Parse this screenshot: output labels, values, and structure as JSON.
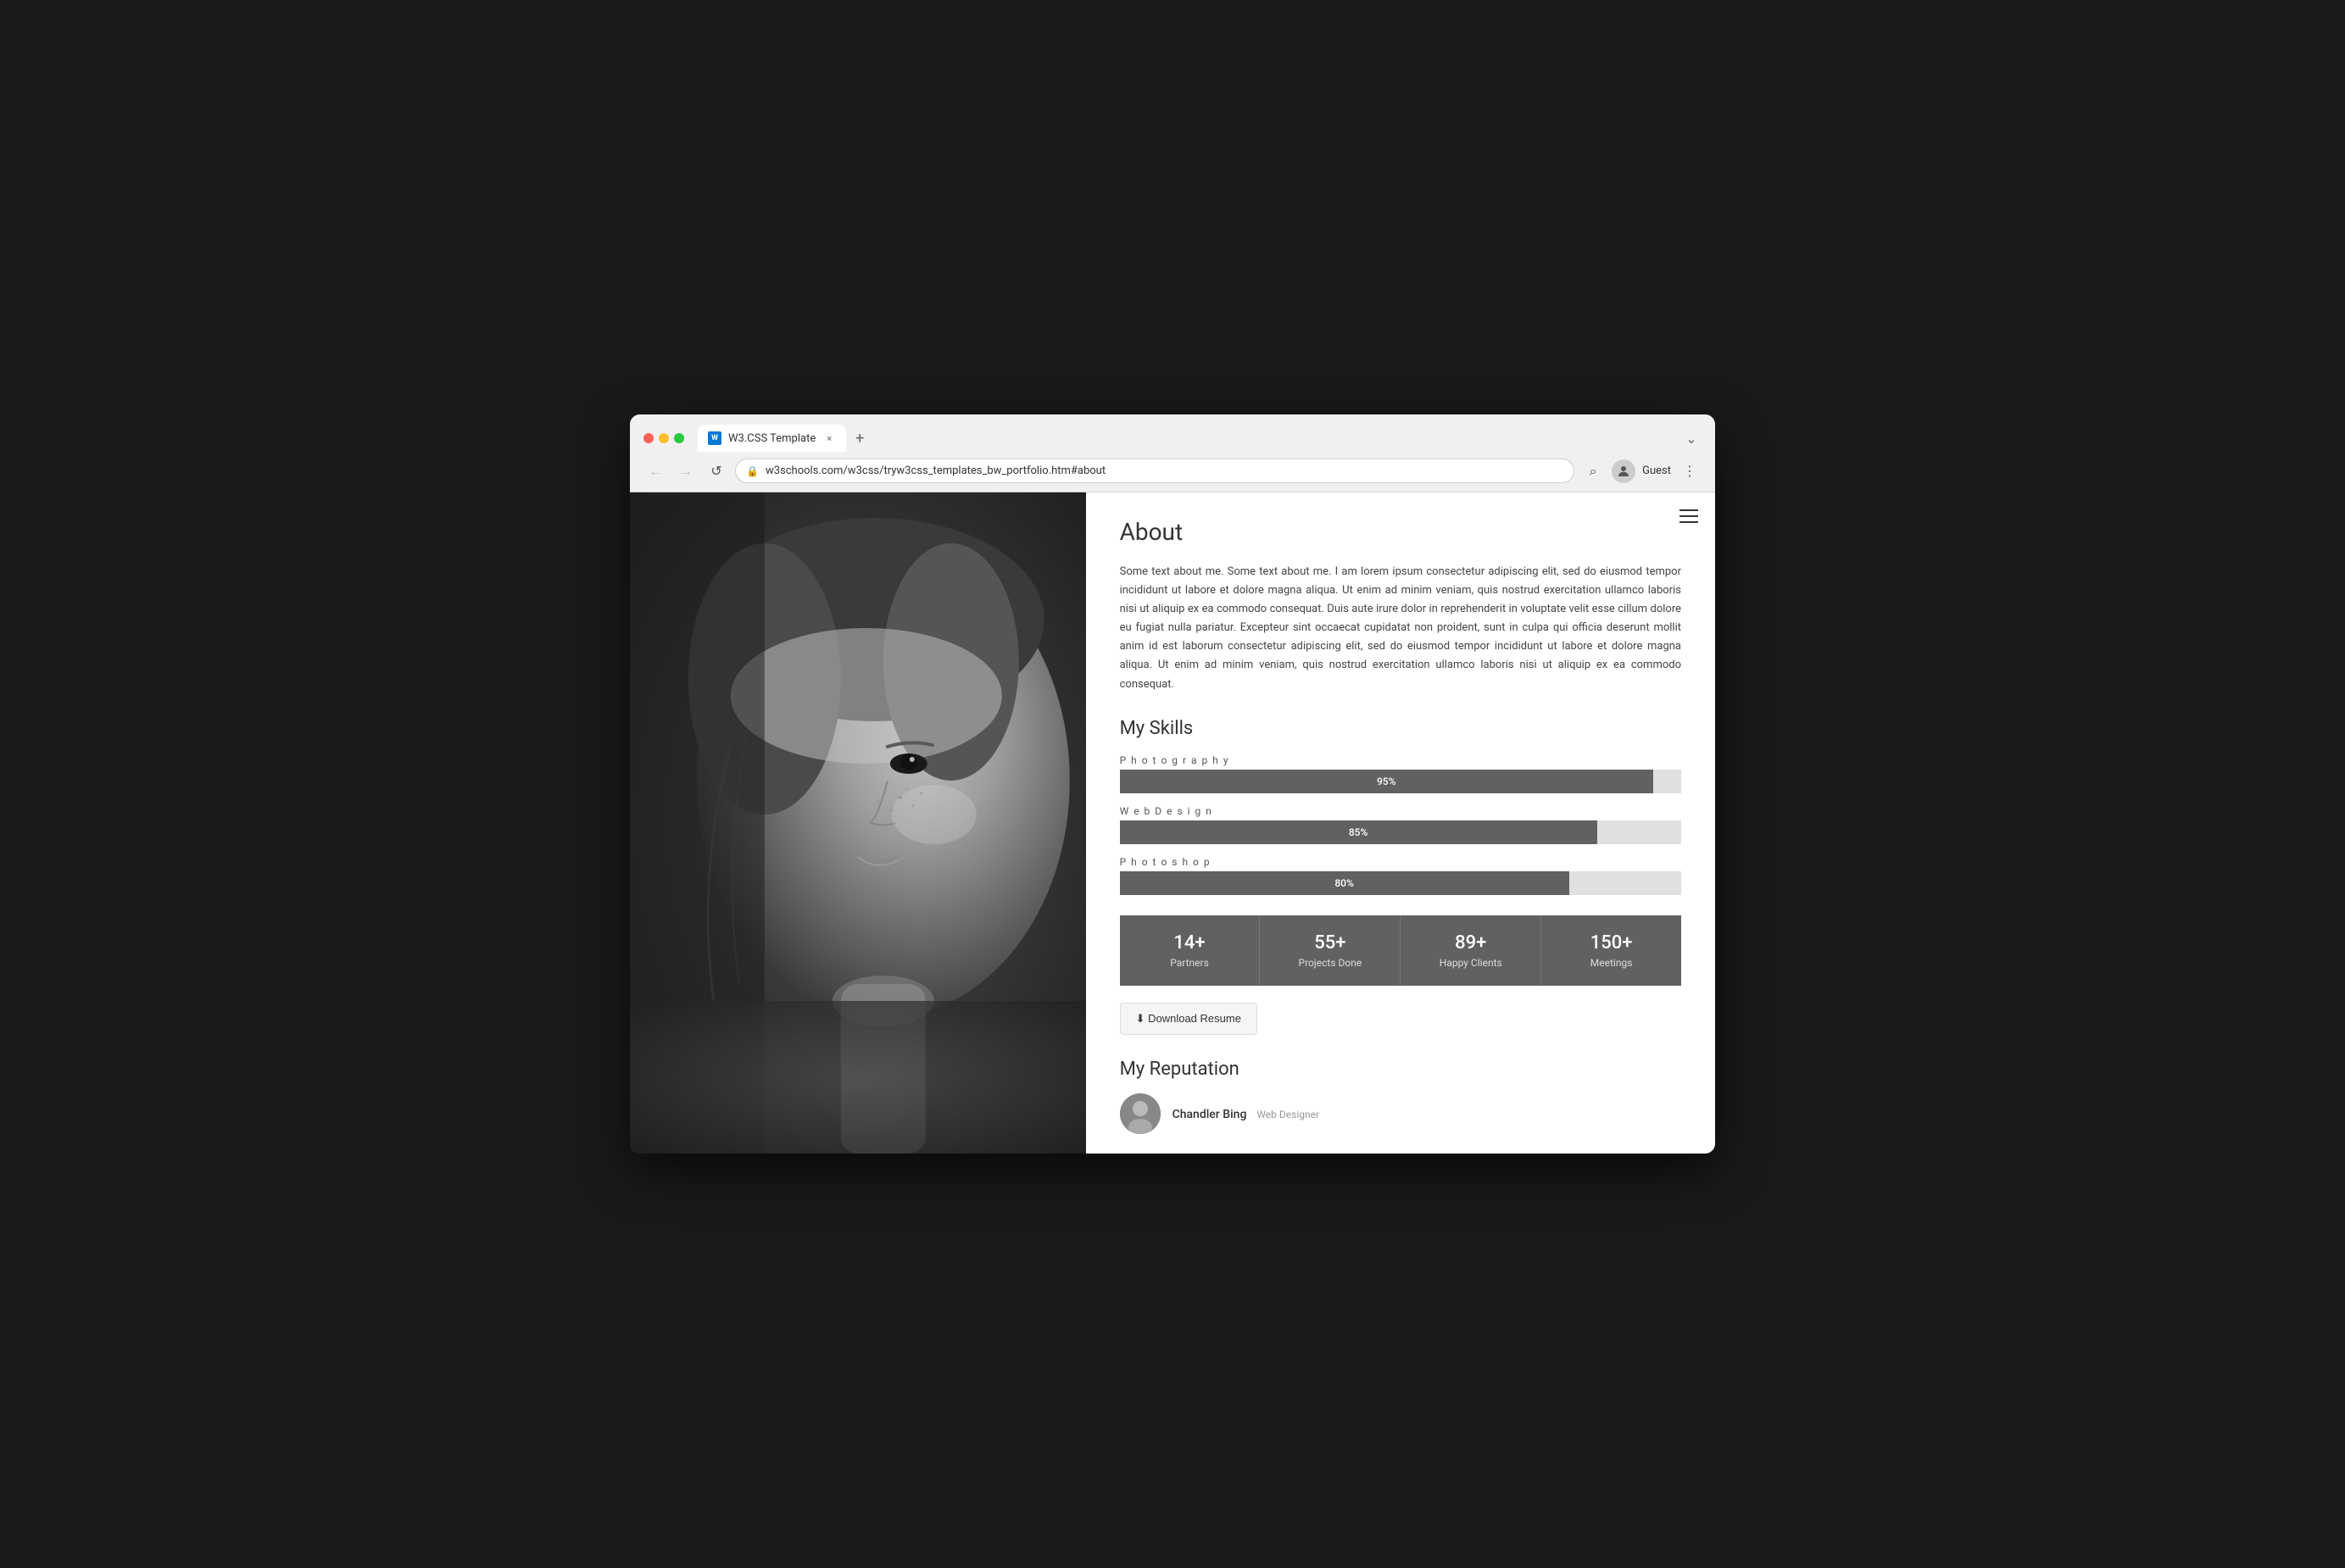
{
  "browser": {
    "tab_favicon": "W",
    "tab_title": "W3.CSS Template",
    "tab_close": "×",
    "tab_new": "+",
    "tab_menu": "⌄",
    "nav_back": "←",
    "nav_forward": "→",
    "nav_refresh": "↺",
    "url": "w3schools.com/w3css/tryw3css_templates_bw_portfolio.htm#about",
    "search_icon": "⌕",
    "user_icon": "👤",
    "user_label": "Guest",
    "more_icon": "⋮"
  },
  "hamburger": "≡",
  "page": {
    "about_title": "About",
    "about_text": "Some text about me. Some text about me. I am lorem ipsum consectetur adipiscing elit, sed do eiusmod tempor incididunt ut labore et dolore magna aliqua. Ut enim ad minim veniam, quis nostrud exercitation ullamco laboris nisi ut aliquip ex ea commodo consequat. Duis aute irure dolor in reprehenderit in voluptate velit esse cillum dolore eu fugiat nulla pariatur. Excepteur sint occaecat cupidatat non proident, sunt in culpa qui officia deserunt mollit anim id est laborum consectetur adipiscing elit, sed do eiusmod tempor incididunt ut labore et dolore magna aliqua. Ut enim ad minim veniam, quis nostrud exercitation ullamco laboris nisi ut aliquip ex ea commodo consequat.",
    "skills_title": "My Skills",
    "skills": [
      {
        "name": "Photography",
        "percent": 95,
        "label": "95%"
      },
      {
        "name": "Web Design",
        "percent": 85,
        "label": "85%"
      },
      {
        "name": "Photoshop",
        "percent": 80,
        "label": "80%"
      }
    ],
    "stats": [
      {
        "number": "14+",
        "label": "Partners"
      },
      {
        "number": "55+",
        "label": "Projects Done"
      },
      {
        "number": "89+",
        "label": "Happy Clients"
      },
      {
        "number": "150+",
        "label": "Meetings"
      }
    ],
    "download_btn": "⬇ Download Resume",
    "reputation_title": "My Reputation",
    "reputation_person_name": "Chandler Bing",
    "reputation_person_role": "Web Designer"
  },
  "colors": {
    "skill_bar_bg": "#616161",
    "stats_bg": "#616161"
  }
}
